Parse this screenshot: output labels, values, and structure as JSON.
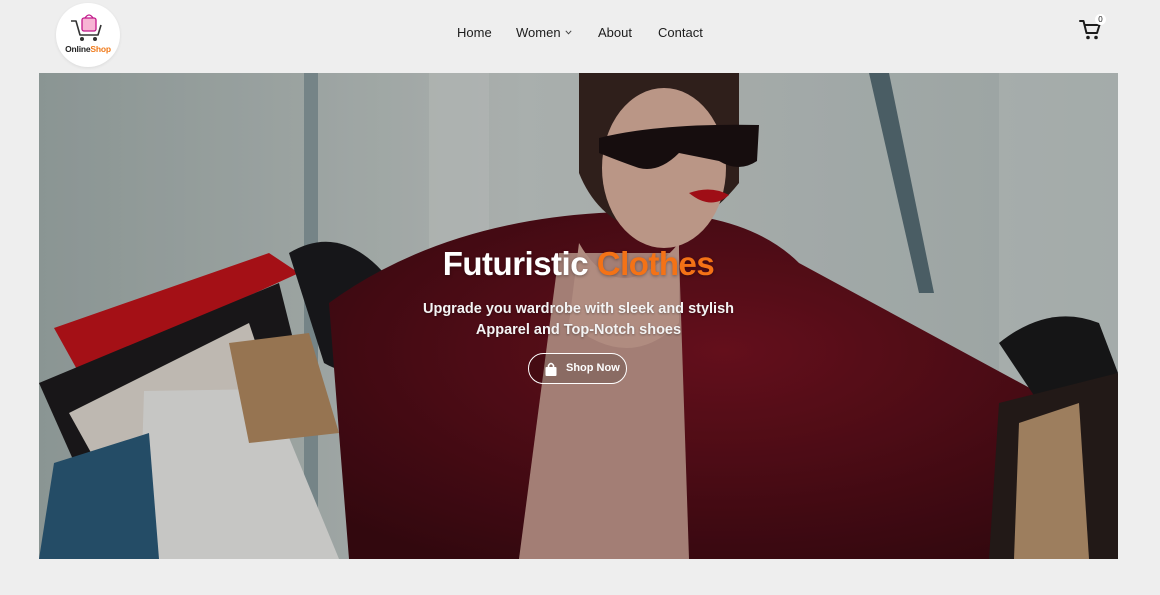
{
  "brand": {
    "logo_text_a": "Online",
    "logo_text_b": "Shop",
    "logo_icon": "shopping-cart-logo-icon",
    "colors": {
      "accent": "#f07a1a",
      "text": "#222222"
    }
  },
  "nav": {
    "items": [
      {
        "label": "Home"
      },
      {
        "label": "Women",
        "has_dropdown": true,
        "dropdown_icon": "chevron-down-icon"
      },
      {
        "label": "About"
      },
      {
        "label": "Contact"
      }
    ]
  },
  "cart": {
    "icon": "cart-icon",
    "count": "0"
  },
  "hero": {
    "title_a": "Futuristic",
    "title_b": "Clothes",
    "subtitle_line1": "Upgrade you wardrobe with sleek and stylish",
    "subtitle_line2": "Apparel and Top-Notch shoes",
    "button_label": "Shop Now",
    "button_icon": "shopping-bag-icon",
    "accent_color": "#f47216"
  }
}
